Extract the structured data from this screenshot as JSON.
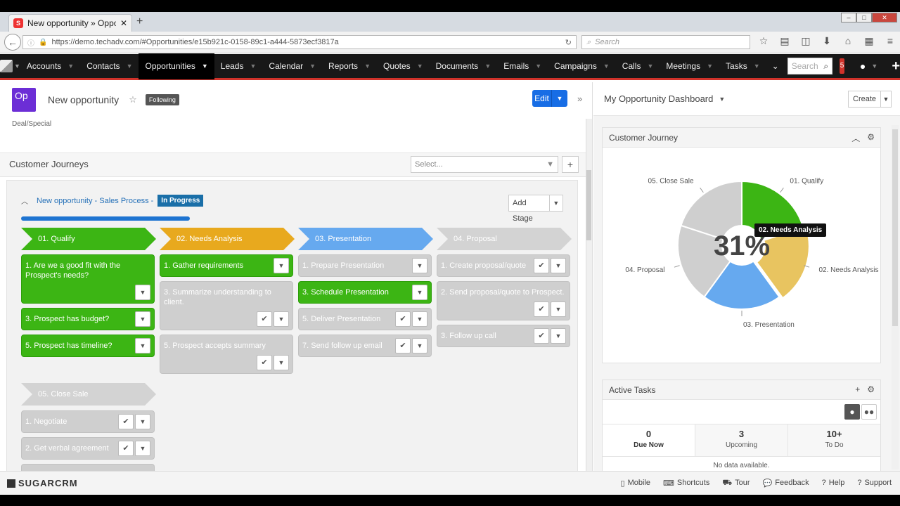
{
  "browser": {
    "tab_title": "New opportunity » Opport...",
    "url": "https://demo.techadv.com/#Opportunities/e15b921c-0158-89c1-a444-5873ecf3817a",
    "search_placeholder": "Search"
  },
  "nav": {
    "items": [
      "Accounts",
      "Contacts",
      "Opportunities",
      "Leads",
      "Calendar",
      "Reports",
      "Quotes",
      "Documents",
      "Emails",
      "Campaigns",
      "Calls",
      "Meetings",
      "Tasks"
    ],
    "active": "Opportunities",
    "search_placeholder": "Search",
    "notifications": "5"
  },
  "record": {
    "badge": "Op",
    "title": "New opportunity",
    "following": "Following",
    "edit_label": "Edit",
    "deal_type": "Deal/Special"
  },
  "journeys": {
    "title": "Customer Journeys",
    "select_placeholder": "Select...",
    "link": "New opportunity - Sales Process -",
    "status": "In Progress",
    "add_stage": "Add Stage",
    "stages": [
      {
        "label": "01. Qualify",
        "color": "#3cb514"
      },
      {
        "label": "02. Needs Analysis",
        "color": "#e8a91e"
      },
      {
        "label": "03. Presentation",
        "color": "#66a9ef"
      },
      {
        "label": "04. Proposal",
        "color": "#d3d3d3"
      },
      {
        "label": "05. Close Sale",
        "color": "#d3d3d3"
      }
    ],
    "activities": {
      "a1": "1. Are we a good fit with the Prospect's needs?",
      "a2": "3. Prospect has budget?",
      "a3": "5. Prospect has timeline?",
      "b1": "1. Gather requirements",
      "b2": "3. Summarize understanding to client.",
      "b3": "5. Prospect accepts summary",
      "c1": "1. Prepare Presentation",
      "c2": "3. Schedule Presentation",
      "c3": "5. Deliver Presentation",
      "c4": "7. Send follow up email",
      "d1": "1. Create proposal/quote",
      "d2": "2. Send proposal/quote to Prospect.",
      "d3": "3. Follow up call",
      "e1": "1. Negotiate",
      "e2": "2. Get verbal agreement"
    }
  },
  "dashboard": {
    "title": "My Opportunity Dashboard",
    "create_label": "Create",
    "journey_title": "Customer Journey",
    "percent": "31%",
    "tooltip": "02. Needs Analysis",
    "pie_labels": [
      "01. Qualify",
      "02. Needs Analysis",
      "03. Presentation",
      "04. Proposal",
      "05. Close Sale"
    ],
    "tasks_title": "Active Tasks",
    "task_tabs": [
      {
        "n": "0",
        "l": "Due Now"
      },
      {
        "n": "3",
        "l": "Upcoming"
      },
      {
        "n": "10+",
        "l": "To Do"
      }
    ],
    "no_data": "No data available."
  },
  "chart_data": {
    "type": "pie",
    "categories": [
      "01. Qualify",
      "02. Needs Analysis",
      "03. Presentation",
      "04. Proposal",
      "05. Close Sale"
    ],
    "values": [
      20,
      20,
      20,
      20,
      20
    ],
    "colors": [
      "#3cb514",
      "#e8c460",
      "#66a9ef",
      "#cfcfcf",
      "#cfcfcf"
    ],
    "center_label": "31%"
  },
  "footer": {
    "brand": "SUGARCRM",
    "links": [
      "Mobile",
      "Shortcuts",
      "Tour",
      "Feedback",
      "Help",
      "Support"
    ]
  }
}
